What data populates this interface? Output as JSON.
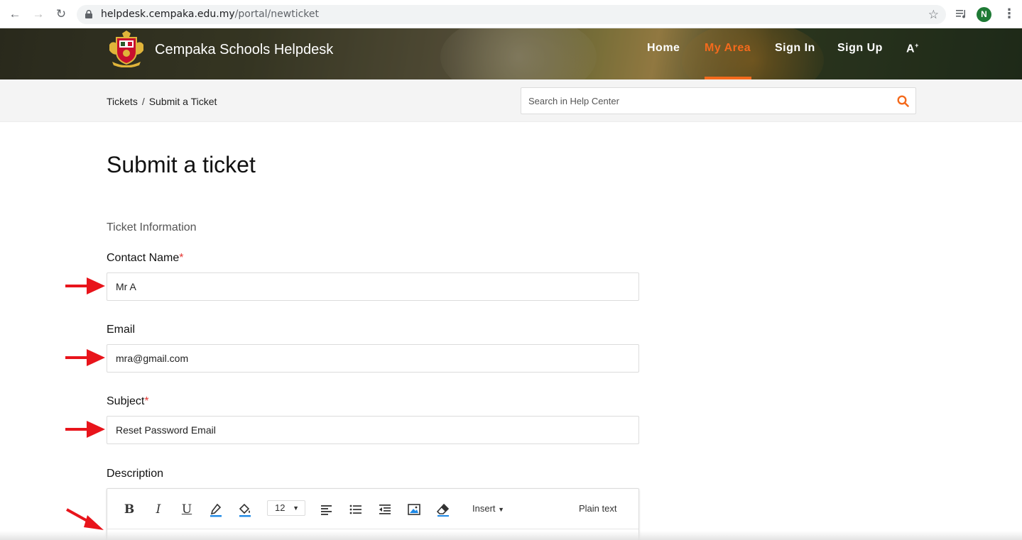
{
  "browser": {
    "url_host": "helpdesk.cempaka.edu.my",
    "url_path": "/portal/newticket",
    "avatar_letter": "N"
  },
  "header": {
    "site_title": "Cempaka Schools Helpdesk",
    "nav": {
      "home": "Home",
      "my_area": "My Area",
      "sign_in": "Sign In",
      "sign_up": "Sign Up",
      "accessibility": "A"
    },
    "accent_color": "#f46a1c"
  },
  "breadcrumb": {
    "tickets": "Tickets",
    "separator": "/",
    "current": "Submit a Ticket"
  },
  "search": {
    "placeholder": "Search in Help Center"
  },
  "main": {
    "title": "Submit a ticket",
    "section_title": "Ticket Information",
    "fields": {
      "contact_name": {
        "label": "Contact Name",
        "required_mark": "*",
        "value": "Mr A"
      },
      "email": {
        "label": "Email",
        "value": "mra@gmail.com"
      },
      "subject": {
        "label": "Subject",
        "required_mark": "*",
        "value": "Reset Password Email"
      },
      "description": {
        "label": "Description"
      }
    },
    "editor": {
      "bold": "B",
      "italic": "I",
      "underline": "U",
      "font_size": "12",
      "insert": "Insert",
      "plain_text": "Plain text"
    }
  }
}
